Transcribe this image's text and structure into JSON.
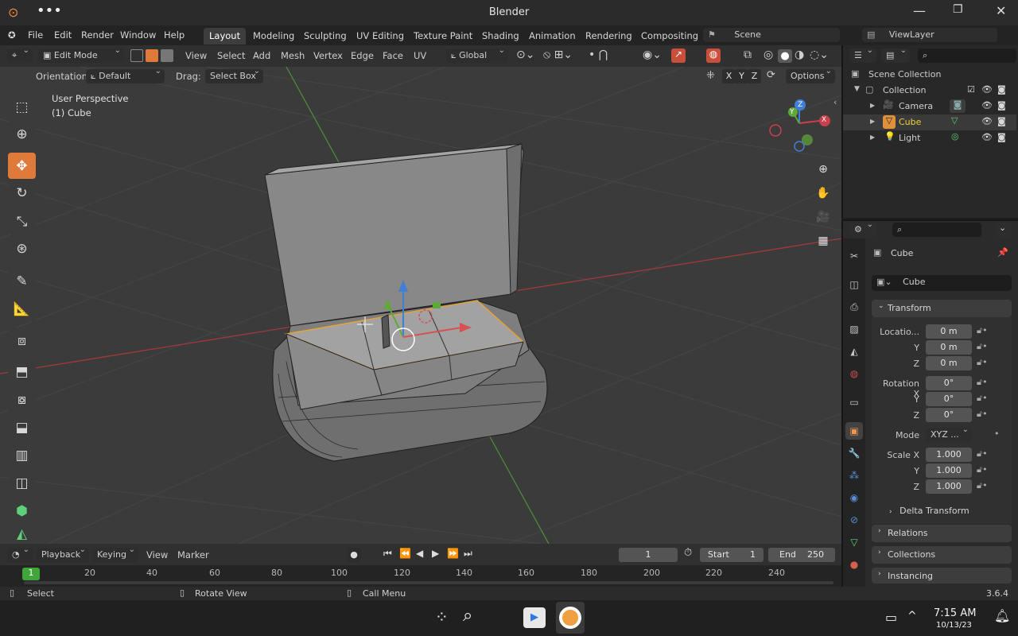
{
  "window": {
    "title": "Blender"
  },
  "menubar": {
    "menus": [
      "File",
      "Edit",
      "Render",
      "Window",
      "Help"
    ],
    "workspaces": [
      "Layout",
      "Modeling",
      "Sculpting",
      "UV Editing",
      "Texture Paint",
      "Shading",
      "Animation",
      "Rendering",
      "Compositing"
    ],
    "active_workspace": "Layout",
    "scene": "Scene",
    "view_layer": "ViewLayer"
  },
  "viewport_header": {
    "mode": "Edit Mode",
    "menus": [
      "View",
      "Select",
      "Add",
      "Mesh",
      "Vertex",
      "Edge",
      "Face",
      "UV"
    ],
    "transform_orientation": "Global",
    "orientation_label": "Orientation:",
    "orientation_value": "Default",
    "drag_label": "Drag:",
    "drag_value": "Select Box",
    "axes": [
      "X",
      "Y",
      "Z"
    ],
    "options": "Options"
  },
  "viewport": {
    "perspective": "User Perspective",
    "object": "(1) Cube",
    "gizmo_axes": [
      "X",
      "Y",
      "Z"
    ],
    "colors": {
      "x_axis": "#c8404a",
      "y_axis": "#5fa83a",
      "z_axis": "#3f7fd6",
      "selection": "#e8a13a"
    }
  },
  "toolbar": {
    "tools": [
      "select-box-tool",
      "cursor-tool",
      "move-tool",
      "rotate-tool",
      "scale-tool",
      "transform-tool",
      "annotate-tool",
      "measure-tool",
      "add-cube-tool",
      "extrude-tool",
      "inset-tool",
      "bevel-tool",
      "loop-cut-tool",
      "knife-tool",
      "poly-build-tool",
      "spin-tool"
    ],
    "active": "move-tool"
  },
  "timeline": {
    "menus": [
      "Playback",
      "Keying",
      "View",
      "Marker"
    ],
    "current_frame": "1",
    "start_label": "Start",
    "start": "1",
    "end_label": "End",
    "end": "250",
    "ticks": [
      "20",
      "40",
      "60",
      "80",
      "100",
      "120",
      "140",
      "160",
      "180",
      "200",
      "220",
      "240"
    ],
    "frame_marker": "1"
  },
  "statusbar": {
    "hints": [
      "Select",
      "Rotate View",
      "Call Menu"
    ],
    "version": "3.6.4"
  },
  "outliner": {
    "root": "Scene Collection",
    "collection": "Collection",
    "items": [
      {
        "name": "Camera",
        "selected": false
      },
      {
        "name": "Cube",
        "selected": true
      },
      {
        "name": "Light",
        "selected": false
      }
    ]
  },
  "properties": {
    "object_name": "Cube",
    "datablock": "Cube",
    "transform_title": "Transform",
    "location_label": "Locatio...",
    "location": [
      "0 m",
      "0 m",
      "0 m"
    ],
    "rotation_label": "Rotation X",
    "rotation": [
      "0°",
      "0°",
      "0°"
    ],
    "mode_label": "Mode",
    "mode_value": "XYZ ...",
    "scale_label": "Scale X",
    "scale": [
      "1.000",
      "1.000",
      "1.000"
    ],
    "axis_y": "Y",
    "axis_z": "Z",
    "delta": "Delta Transform",
    "panels": [
      "Relations",
      "Collections",
      "Instancing"
    ]
  },
  "taskbar": {
    "time": "7:15 AM",
    "date": "10/13/23"
  }
}
